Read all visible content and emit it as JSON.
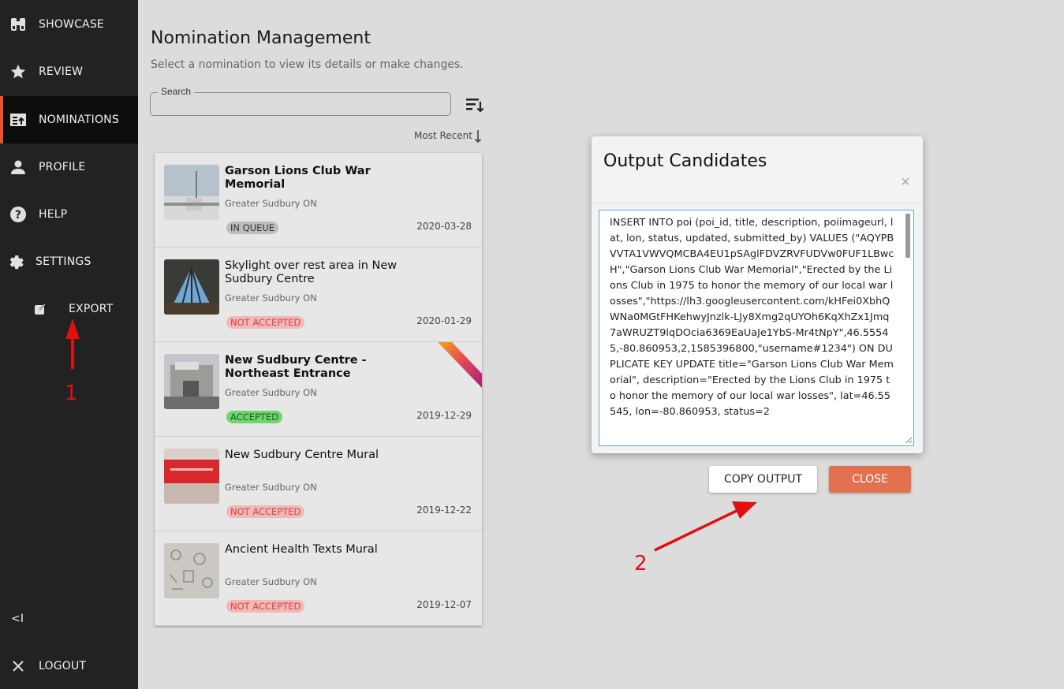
{
  "sidebar": {
    "items": [
      {
        "label": "SHOWCASE",
        "icon": "binoculars-icon"
      },
      {
        "label": "REVIEW",
        "icon": "star-icon"
      },
      {
        "label": "NOMINATIONS",
        "icon": "nominations-icon"
      },
      {
        "label": "PROFILE",
        "icon": "person-icon"
      },
      {
        "label": "HELP",
        "icon": "help-icon"
      },
      {
        "label": "SETTINGS",
        "icon": "gear-icon"
      },
      {
        "label": "EXPORT",
        "icon": "export-icon"
      }
    ],
    "collapse": "<I",
    "logout": "LOGOUT"
  },
  "page": {
    "title": "Nomination Management",
    "subtitle": "Select a nomination to view its details or make changes."
  },
  "search": {
    "label": "Search",
    "value": ""
  },
  "sort": {
    "label": "Most Recent"
  },
  "nominations": [
    {
      "title": "Garson Lions Club War Memorial",
      "location": "Greater Sudbury ON",
      "status": "IN QUEUE",
      "date": "2020-03-28",
      "bold": true
    },
    {
      "title": "Skylight over rest area in New Sudbury Centre",
      "location": "Greater Sudbury ON",
      "status": "NOT ACCEPTED",
      "date": "2020-01-29",
      "bold": false
    },
    {
      "title": "New Sudbury Centre - Northeast Entrance",
      "location": "Greater Sudbury ON",
      "status": "ACCEPTED",
      "date": "2019-12-29",
      "bold": true
    },
    {
      "title": "New Sudbury Centre Mural",
      "location": "Greater Sudbury ON",
      "status": "NOT ACCEPTED",
      "date": "2019-12-22",
      "bold": false
    },
    {
      "title": "Ancient Health Texts Mural",
      "location": "Greater Sudbury ON",
      "status": "NOT ACCEPTED",
      "date": "2019-12-07",
      "bold": false
    }
  ],
  "modal": {
    "title": "Output Candidates",
    "close_icon": "×",
    "output": "INSERT INTO poi (poi_id, title, description, poiimageurl, lat, lon, status, updated, submitted_by) VALUES (\"AQYPBVVTA1VWVQMCBA4EU1pSAglFDVZRVFUDVw0FUF1LBwcH\",\"Garson Lions Club War Memorial\",\"Erected by the Lions Club in 1975 to honor the memory of our local war losses\",\"https://lh3.googleusercontent.com/kHFei0XbhQWNa0MGtFHKehwyJnzlk-LJy8Xmg2qUYOh6KqXhZx1Jmq7aWRUZT9lqDOcia6369EaUaJe1YbS-Mr4tNpY\",46.55545,-80.860953,2,1585396800,\"username#1234\") ON DUPLICATE KEY UPDATE title=\"Garson Lions Club War Memorial\", description=\"Erected by the Lions Club in 1975 to honor the memory of our local war losses\", lat=46.55545, lon=-80.860953, status=2",
    "copy_label": "COPY OUTPUT",
    "close_label": "CLOSE"
  },
  "annotations": [
    "1",
    "2"
  ],
  "colors": {
    "sidebar_bg": "#222222",
    "accent": "#e8542d",
    "close_button": "#e2714f",
    "annotation": "#e01010"
  }
}
